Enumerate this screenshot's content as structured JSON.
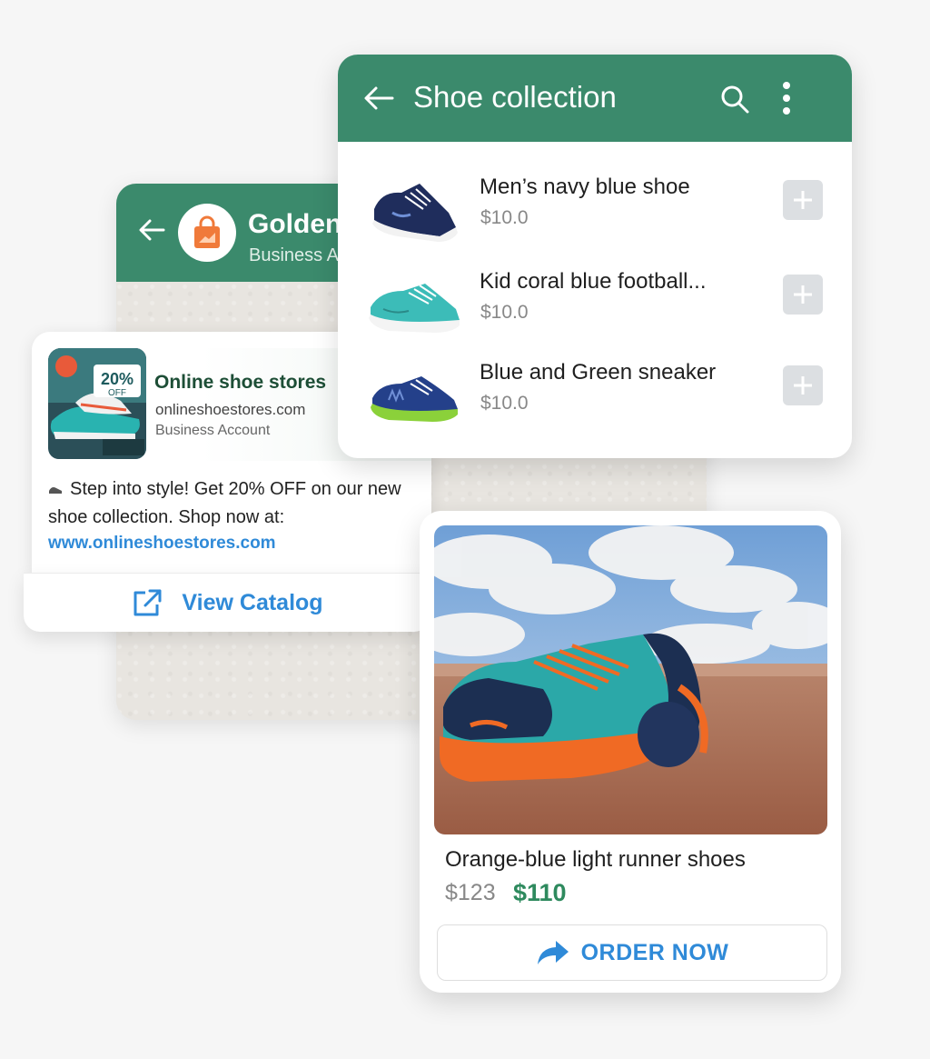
{
  "chat": {
    "title": "Golden",
    "subtitle": "Business A"
  },
  "promo": {
    "store_name": "Online shoe stores",
    "site": "onlineshoestores.com",
    "account": "Business Account",
    "thumb_badge": "20%",
    "thumb_badge_sub": "OFF",
    "message": "Step into style! Get 20% OFF on our new shoe collection. Shop now at:",
    "link": "www.onlineshoestores.com",
    "catalog_button": "View Catalog"
  },
  "collection": {
    "title": "Shoe collection",
    "items": [
      {
        "name": "Men’s navy blue shoe",
        "price": "$10.0"
      },
      {
        "name": "Kid coral blue football...",
        "price": "$10.0"
      },
      {
        "name": "Blue and Green sneaker",
        "price": "$10.0"
      }
    ]
  },
  "product": {
    "name": "Orange-blue light runner shoes",
    "old_price": "$123",
    "new_price": "$110",
    "order_button": "ORDER NOW"
  },
  "icons": {
    "back": "arrow-left-icon",
    "search": "search-icon",
    "menu": "more-vertical-icon",
    "add": "plus-icon",
    "external": "external-link-icon",
    "share": "share-arrow-icon",
    "bag": "shopping-bag-icon"
  },
  "colors": {
    "header_green": "#3b8a6c",
    "link_blue": "#2f8ad8",
    "price_green": "#2e8a5e",
    "bag_orange": "#f07a3a"
  }
}
